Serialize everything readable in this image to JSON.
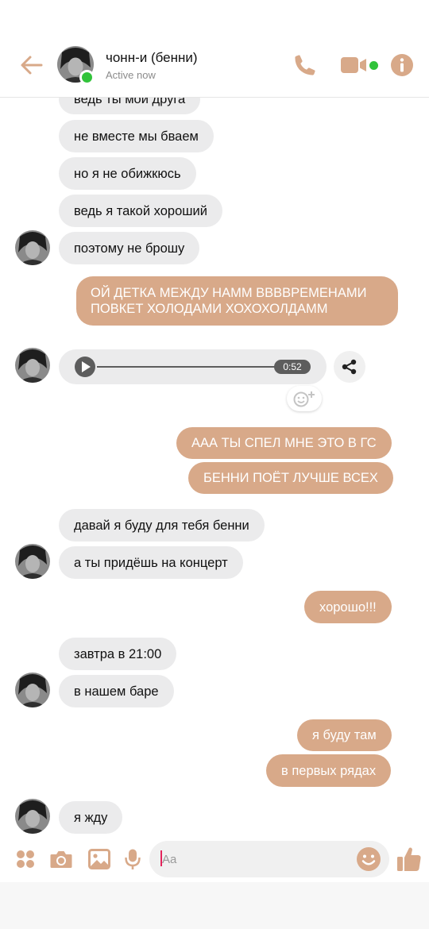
{
  "header": {
    "contact_name": "чонн-и (бенни)",
    "status": "Active now"
  },
  "colors": {
    "accent": "#d8a989",
    "incoming_bubble": "#ebebec",
    "online": "#31c33a"
  },
  "icons": [
    "back-arrow-icon",
    "phone-icon",
    "video-camera-icon",
    "info-icon",
    "play-icon",
    "share-icon",
    "add-reaction-icon",
    "apps-icon",
    "camera-icon",
    "gallery-icon",
    "microphone-icon",
    "emoji-icon",
    "thumbs-up-icon"
  ],
  "messages": [
    {
      "dir": "in",
      "text": "ведь ты мой друга"
    },
    {
      "dir": "in",
      "text": "не вместе мы бваем"
    },
    {
      "dir": "in",
      "text": "но я не обижкюсь"
    },
    {
      "dir": "in",
      "text": "ведь я такой хороший"
    },
    {
      "dir": "in",
      "text": "поэтому не брошу"
    },
    {
      "dir": "out",
      "lines": [
        "ОЙ ДЕТКА МЕЖДУ НАММ ВВВВРЕМЕНАМИ",
        "ПОВКЕТ ХОЛОДАМИ ХОХОХОЛДАММ"
      ]
    },
    {
      "dir": "in",
      "type": "voice",
      "duration": "0:52"
    },
    {
      "dir": "out",
      "text": "ААА ТЫ СПЕЛ МНЕ ЭТО В ГС"
    },
    {
      "dir": "out",
      "text": "БЕННИ ПОЁТ ЛУЧШЕ ВСЕХ"
    },
    {
      "dir": "in",
      "text": "давай я буду для тебя бенни"
    },
    {
      "dir": "in",
      "text": "а ты придёшь на концерт"
    },
    {
      "dir": "out",
      "text": "хорошо!!!"
    },
    {
      "dir": "in",
      "text": "завтра в 21:00"
    },
    {
      "dir": "in",
      "text": "в нашем баре"
    },
    {
      "dir": "out",
      "text": "я буду там"
    },
    {
      "dir": "out",
      "text": "в первых рядах"
    },
    {
      "dir": "in",
      "text": "я жду"
    }
  ],
  "composer": {
    "placeholder": "Aa"
  }
}
